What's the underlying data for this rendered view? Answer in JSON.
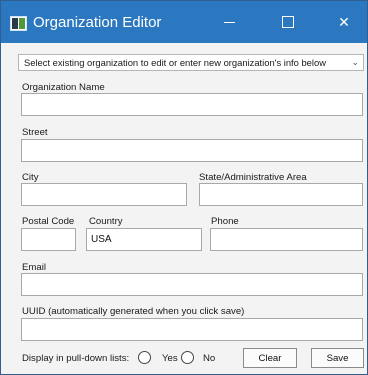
{
  "window": {
    "title": "Organization Editor",
    "minimize_glyph": "",
    "close_glyph": "✕"
  },
  "selector": {
    "text": "Select existing organization to edit or enter new organization's info below",
    "arrow": "⌄"
  },
  "fields": {
    "org_name": {
      "label": "Organization Name",
      "value": ""
    },
    "street": {
      "label": "Street",
      "value": ""
    },
    "city": {
      "label": "City",
      "value": ""
    },
    "state": {
      "label": "State/Administrative Area",
      "value": ""
    },
    "postal_code": {
      "label": "Postal Code",
      "value": ""
    },
    "country": {
      "label": "Country",
      "value": "USA"
    },
    "phone": {
      "label": "Phone",
      "value": ""
    },
    "email": {
      "label": "Email",
      "value": ""
    },
    "uuid": {
      "label": "UUID (automatically generated when you click save)",
      "value": ""
    }
  },
  "display": {
    "label": "Display in pull-down lists:",
    "yes_label": "Yes",
    "no_label": "No"
  },
  "buttons": {
    "clear": "Clear",
    "save": "Save"
  }
}
